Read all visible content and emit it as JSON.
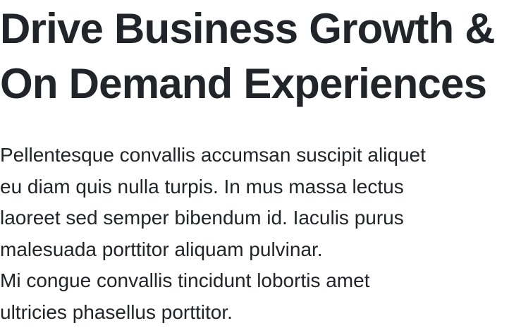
{
  "hero": {
    "title_lines": [
      "Drive Business Growth &",
      "On Demand Experiences"
    ],
    "paragraph_1_lines": [
      "Pellentesque convallis accumsan suscipit aliquet",
      "eu diam quis nulla turpis. In mus massa lectus",
      "laoreet sed semper bibendum id. Iaculis purus",
      "malesuada porttitor aliquam pulvinar."
    ],
    "paragraph_2_lines": [
      "Mi congue convallis tincidunt lobortis amet",
      "ultricies phasellus porttitor."
    ]
  },
  "colors": {
    "text": "#212529",
    "background": "#ffffff"
  }
}
